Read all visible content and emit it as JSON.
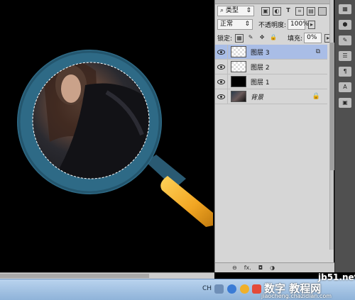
{
  "panel": {
    "filter_label": "类型",
    "blend_mode": "正常",
    "opacity_label": "不透明度:",
    "opacity_value": "100%",
    "lock_label": "锁定:",
    "fill_label": "填充:",
    "fill_value": "0%",
    "layers": [
      {
        "name": "图层 3",
        "selected": true,
        "badge": "link"
      },
      {
        "name": "图层 2",
        "selected": false
      },
      {
        "name": "图层 1",
        "selected": false
      },
      {
        "name": "背景",
        "selected": false,
        "italic": true,
        "badge": "lock"
      }
    ],
    "bottom_fx": "fx."
  },
  "taskbar": {
    "ime": "CH"
  },
  "watermark": {
    "site": "jb51.net",
    "line2": "数字 教程网",
    "line3": "jiaocheng.chazidian.com"
  },
  "colors": {
    "canvas_bg": "#000000",
    "lens_ring": "#2e6a86",
    "handle": "#f2a623",
    "selected_layer": "#a9bde6"
  }
}
